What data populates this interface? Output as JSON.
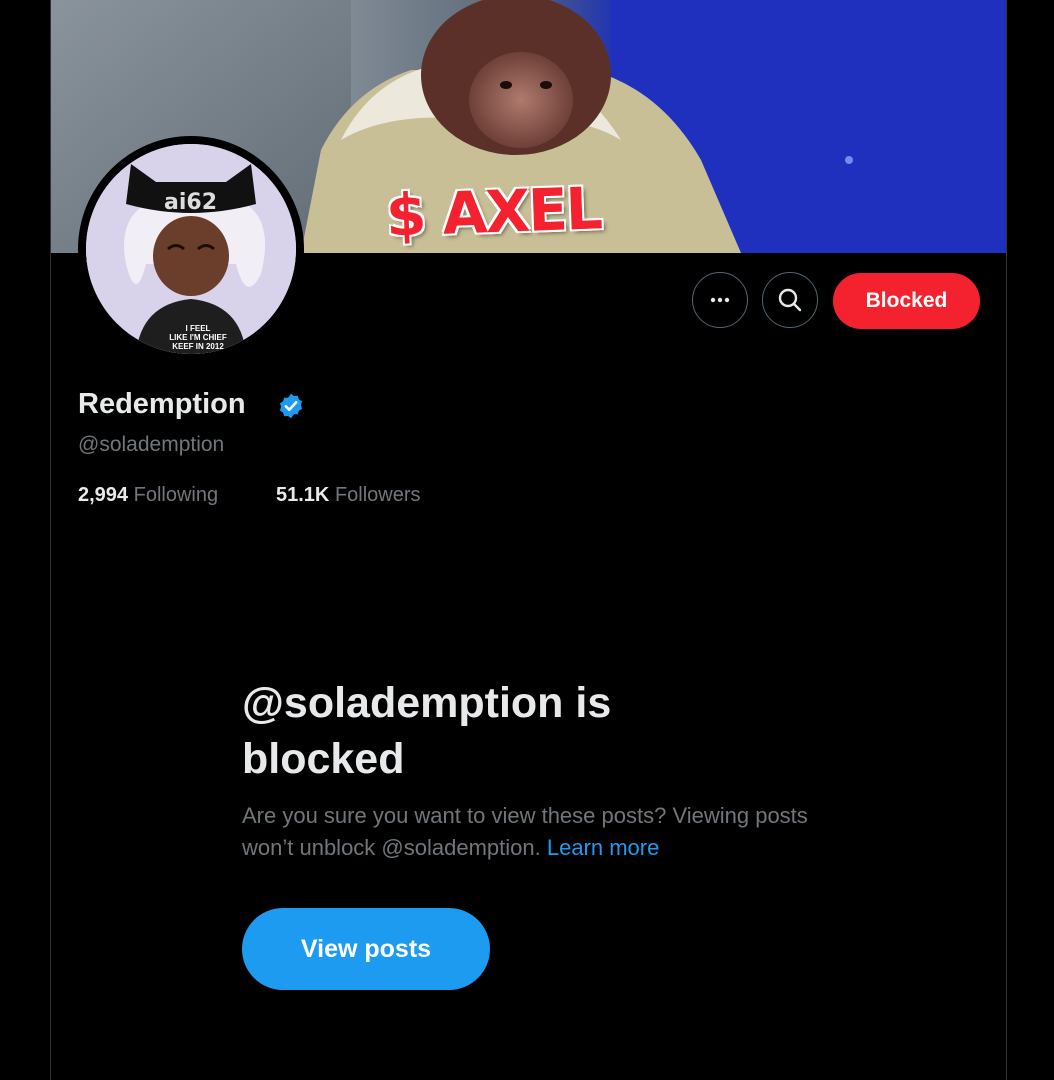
{
  "banner": {
    "caption": "$ AXEL"
  },
  "avatar": {
    "hat_text": "ai62",
    "shirt_text": [
      "I FEEL",
      "LIKE I'M CHIEF",
      "KEEF IN 2012"
    ]
  },
  "actions": {
    "more_icon": "more-horizontal-icon",
    "search_icon": "search-icon",
    "blocked_label": "Blocked"
  },
  "profile": {
    "name": "Redemption",
    "handle": "@solademption",
    "following_count": "2,994",
    "following_label": "Following",
    "followers_count": "51.1K",
    "followers_label": "Followers"
  },
  "blocked_notice": {
    "title": "@solademption is blocked",
    "body": "Are you sure you want to view these posts? Viewing posts won’t unblock @solademption.",
    "learn_more": "Learn more",
    "view_posts": "View posts"
  },
  "colors": {
    "background": "#000000",
    "blocked_red": "#f4212e",
    "accent_blue": "#1d9bf0",
    "secondary_text": "#71767b"
  }
}
